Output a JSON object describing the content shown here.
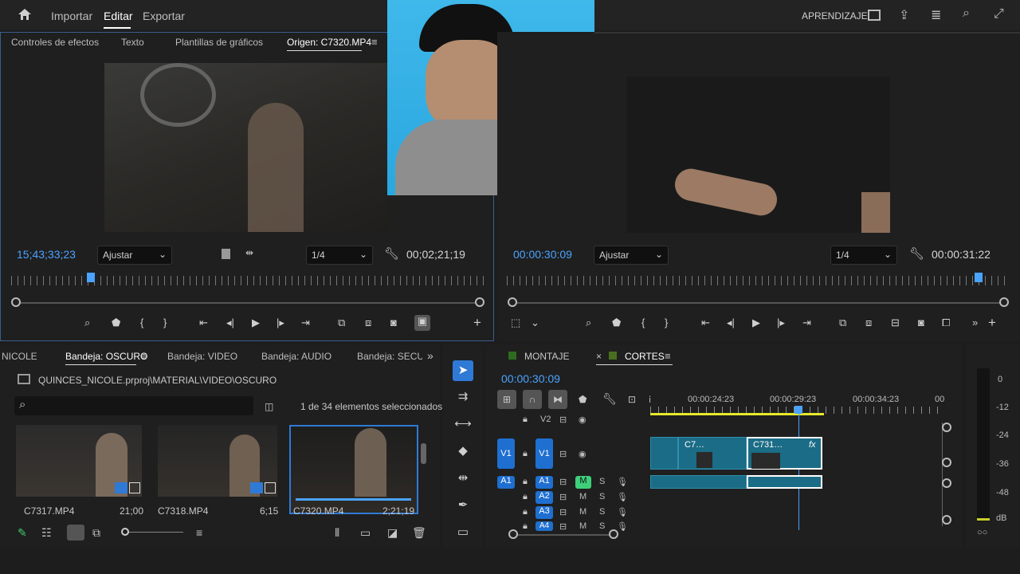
{
  "topbar": {
    "menu": [
      "Importar",
      "Editar",
      "Exportar"
    ],
    "learn": "APRENDIZAJE"
  },
  "source": {
    "tabs": [
      "Controles de efectos",
      "Texto",
      "Plantillas de gráficos",
      "Origen: C7320.MP4"
    ],
    "tc_left": "15;43;33;23",
    "fit": "Ajustar",
    "res": "1/4",
    "tc_right": "00;02;21;19"
  },
  "program": {
    "tc_left": "00:00:30:09",
    "fit": "Ajustar",
    "res": "1/4",
    "tc_right": "00:00:31:22"
  },
  "project": {
    "tabs": [
      "NICOLE",
      "Bandeja: OSCURO",
      "Bandeja: VIDEO",
      "Bandeja: AUDIO",
      "Bandeja: SECUEN"
    ],
    "path": "QUINCES_NICOLE.prproj\\MATERIAL\\VIDEO\\OSCURO",
    "selection": "1 de 34 elementos seleccionados",
    "items": [
      {
        "name": "C7317.MP4",
        "dur": "21;00"
      },
      {
        "name": "C7318.MP4",
        "dur": "6;15"
      },
      {
        "name": "C7320.MP4",
        "dur": "2;21;19"
      }
    ]
  },
  "timeline": {
    "tabs": [
      "MONTAJE",
      "CORTES"
    ],
    "tc": "00:00:30:09",
    "ruler": [
      "00:00:24:23",
      "00:00:29:23",
      "00:00:34:23",
      "00"
    ],
    "tracks": {
      "v2": "V2",
      "v1": "V1",
      "a1": "A1",
      "a2": "A2",
      "a3": "A3",
      "a4": "A4",
      "m": "M",
      "s": "S"
    },
    "clips": [
      "C7…",
      "C731…",
      "fx"
    ]
  },
  "meter": {
    "labels": [
      "0",
      "-12",
      "-24",
      "-36",
      "-48",
      "dB"
    ]
  }
}
